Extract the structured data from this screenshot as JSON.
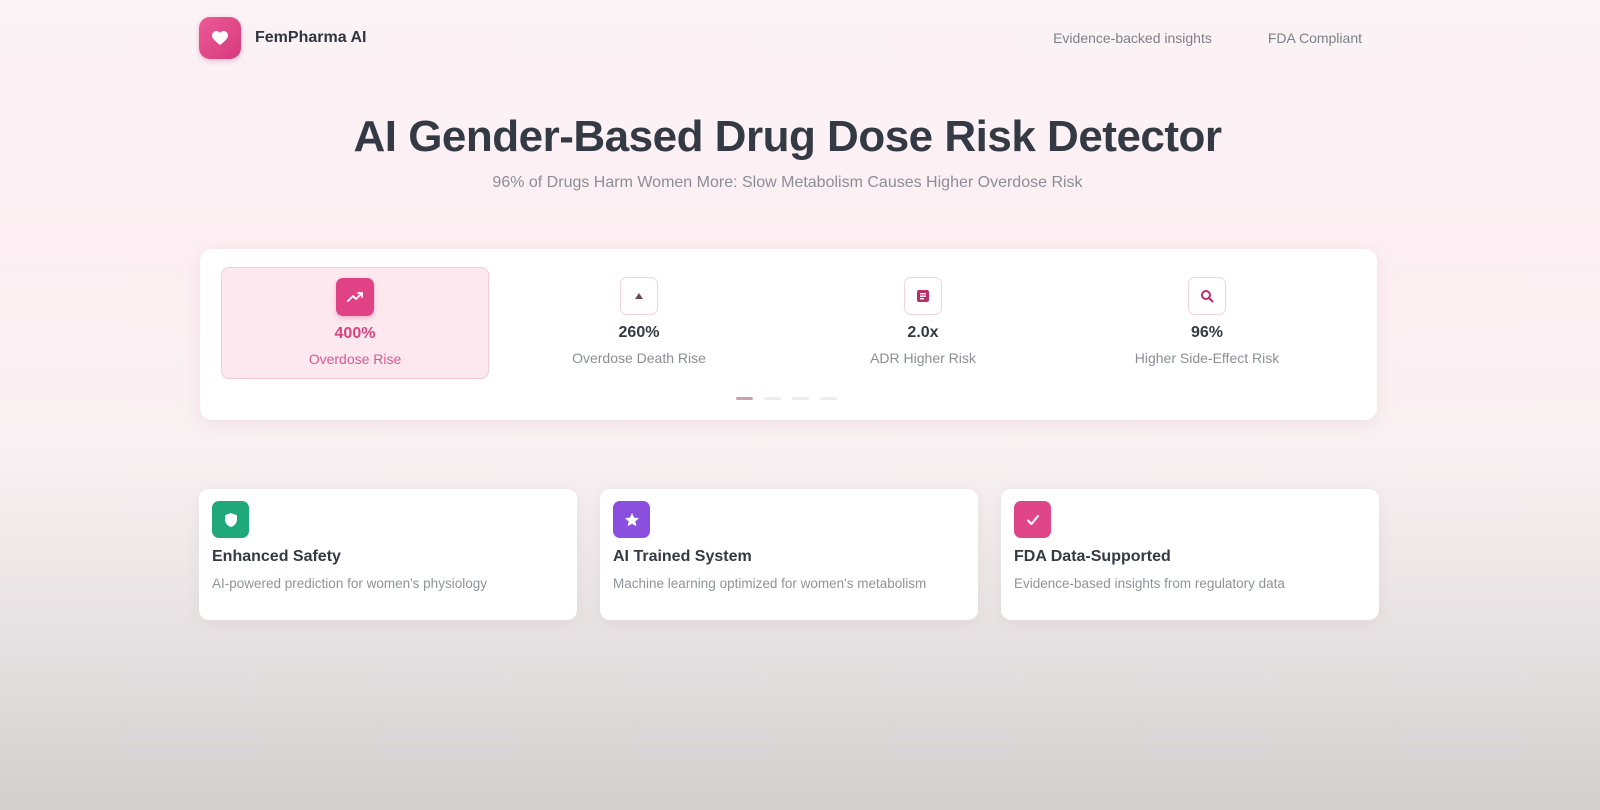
{
  "header": {
    "brand": "FemPharma AI",
    "nav": [
      "Evidence-backed insights",
      "FDA Compliant"
    ]
  },
  "hero": {
    "title": "AI Gender-Based Drug Dose Risk Detector",
    "subtitle": "96% of Drugs Harm Women More: Slow Metabolism Causes Higher Overdose Risk"
  },
  "stats": [
    {
      "value": "400%",
      "label": "Overdose Rise",
      "icon": "trending-up-icon",
      "active": true
    },
    {
      "value": "260%",
      "label": "Overdose Death Rise",
      "icon": "caret-up-icon",
      "active": false
    },
    {
      "value": "2.0x",
      "label": "ADR Higher Risk",
      "icon": "document-icon",
      "active": false
    },
    {
      "value": "96%",
      "label": "Higher Side-Effect Risk",
      "icon": "search-icon",
      "active": false
    }
  ],
  "carousel": {
    "count": 4,
    "active_index": 0
  },
  "features": [
    {
      "title": "Enhanced Safety",
      "description": "AI-powered prediction for women's physiology",
      "icon": "shield-icon",
      "color": "#1fa97a"
    },
    {
      "title": "AI Trained System",
      "description": "Machine learning optimized for women's metabolism",
      "icon": "star-icon",
      "color": "#8b4fe0"
    },
    {
      "title": "FDA Data-Supported",
      "description": "Evidence-based insights from regulatory data",
      "icon": "check-icon",
      "color": "#e0458a"
    }
  ],
  "colors": {
    "accent": "#e04285",
    "accent_light": "#fde8ef",
    "text_dark": "#343a44",
    "text_muted": "#8a8e96"
  }
}
